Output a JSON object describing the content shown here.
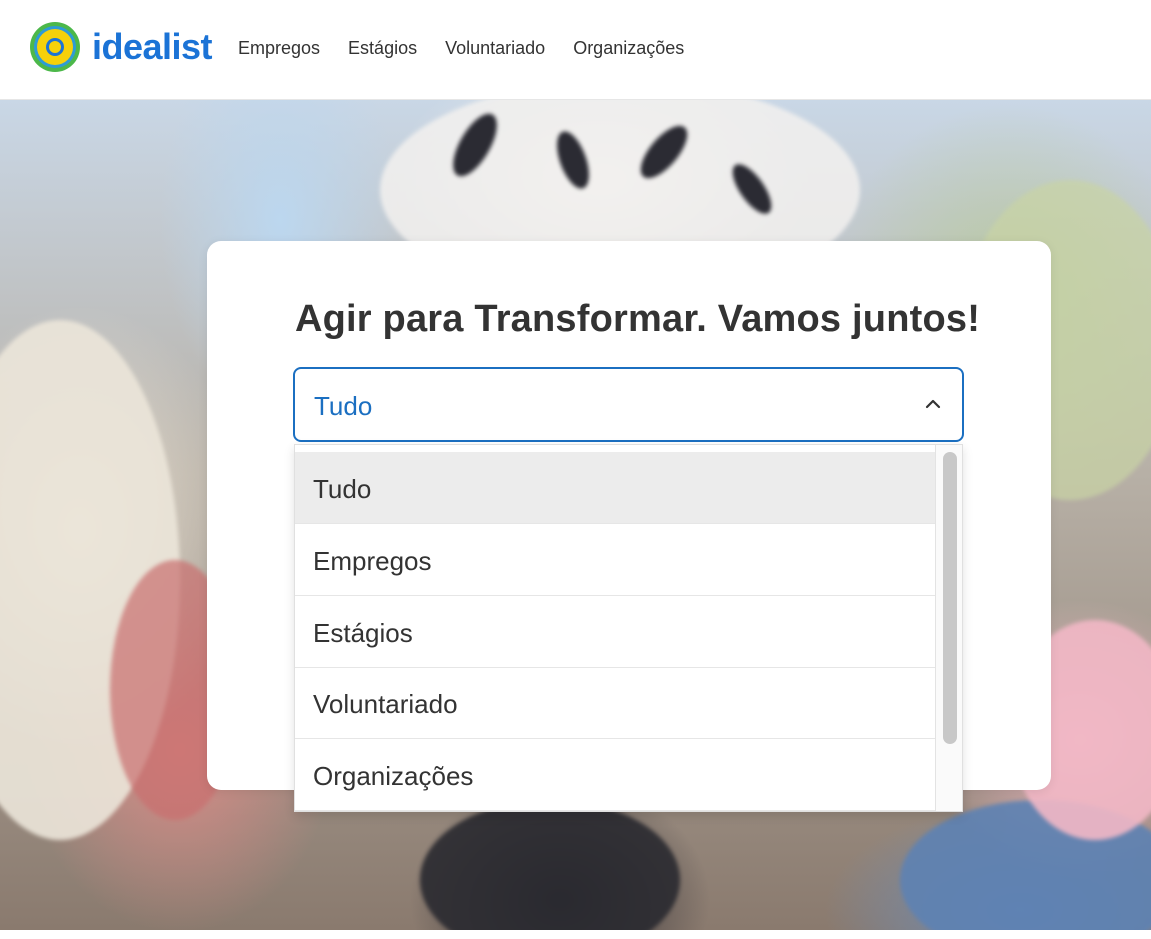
{
  "header": {
    "logo_text": "idealist",
    "nav": [
      {
        "label": "Empregos"
      },
      {
        "label": "Estágios"
      },
      {
        "label": "Voluntariado"
      },
      {
        "label": "Organizações"
      }
    ]
  },
  "hero": {
    "title": "Agir para Transformar. Vamos juntos!",
    "select": {
      "value": "Tudo",
      "expanded": true,
      "options": [
        {
          "label": "Tudo",
          "selected": true
        },
        {
          "label": "Empregos",
          "selected": false
        },
        {
          "label": "Estágios",
          "selected": false
        },
        {
          "label": "Voluntariado",
          "selected": false
        },
        {
          "label": "Organizações",
          "selected": false
        }
      ]
    }
  },
  "colors": {
    "brand_blue": "#1b73d6",
    "select_border": "#1b6fc1",
    "logo_yellow": "#f5d10a",
    "logo_green": "#4cb84a",
    "text_dark": "#333333",
    "option_selected_bg": "#ececec"
  }
}
